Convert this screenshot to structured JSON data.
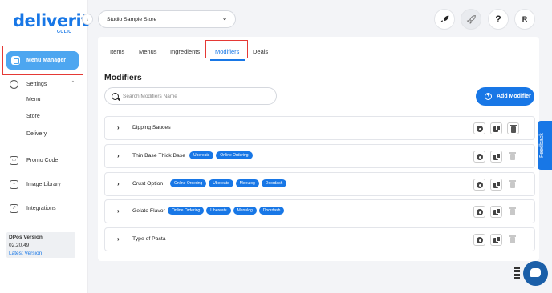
{
  "brand": {
    "logo": "deliverit",
    "sub": "GOLIO"
  },
  "sidebar": {
    "collapse_icon": "‹",
    "active_item": "Menu Manager",
    "settings": "Settings",
    "settings_sub": [
      "Menu",
      "Store",
      "Delivery"
    ],
    "promo_code": "Promo Code",
    "image_library": "Image Library",
    "integrations": "Integrations",
    "version_label": "DPos Version",
    "version_number": "02.20.49",
    "latest_version_link": "Latest Version"
  },
  "header": {
    "store_name": "Studio Sample Store",
    "rocket_icon": "rocket-icon",
    "help_label": "?",
    "avatar_initial": "R"
  },
  "tabs": [
    "Items",
    "Menus",
    "Ingredients",
    "Modifiers",
    "Deals"
  ],
  "active_tab": "Modifiers",
  "main": {
    "title": "Modifiers",
    "search_placeholder": "Search Modifiers Name",
    "add_button": "Add Modifier"
  },
  "modifiers": [
    {
      "name": "Dipping Sauces",
      "tags": []
    },
    {
      "name": "Thin Base Thick Base",
      "tags": [
        "Ubereats",
        "Online Ordering"
      ]
    },
    {
      "name": "Crust Option",
      "tags": [
        "Online Ordering",
        "Ubereats",
        "Menulog",
        "Doordash"
      ]
    },
    {
      "name": "Gelato Flavor",
      "tags": [
        "Online Ordering",
        "Ubereats",
        "Menulog",
        "Doordash"
      ]
    },
    {
      "name": "Type of Pasta",
      "tags": []
    }
  ],
  "feedback_label": "Feedback",
  "colors": {
    "accent": "#1877e6",
    "highlight": "#e53935",
    "active_nav": "#4da6f0"
  }
}
